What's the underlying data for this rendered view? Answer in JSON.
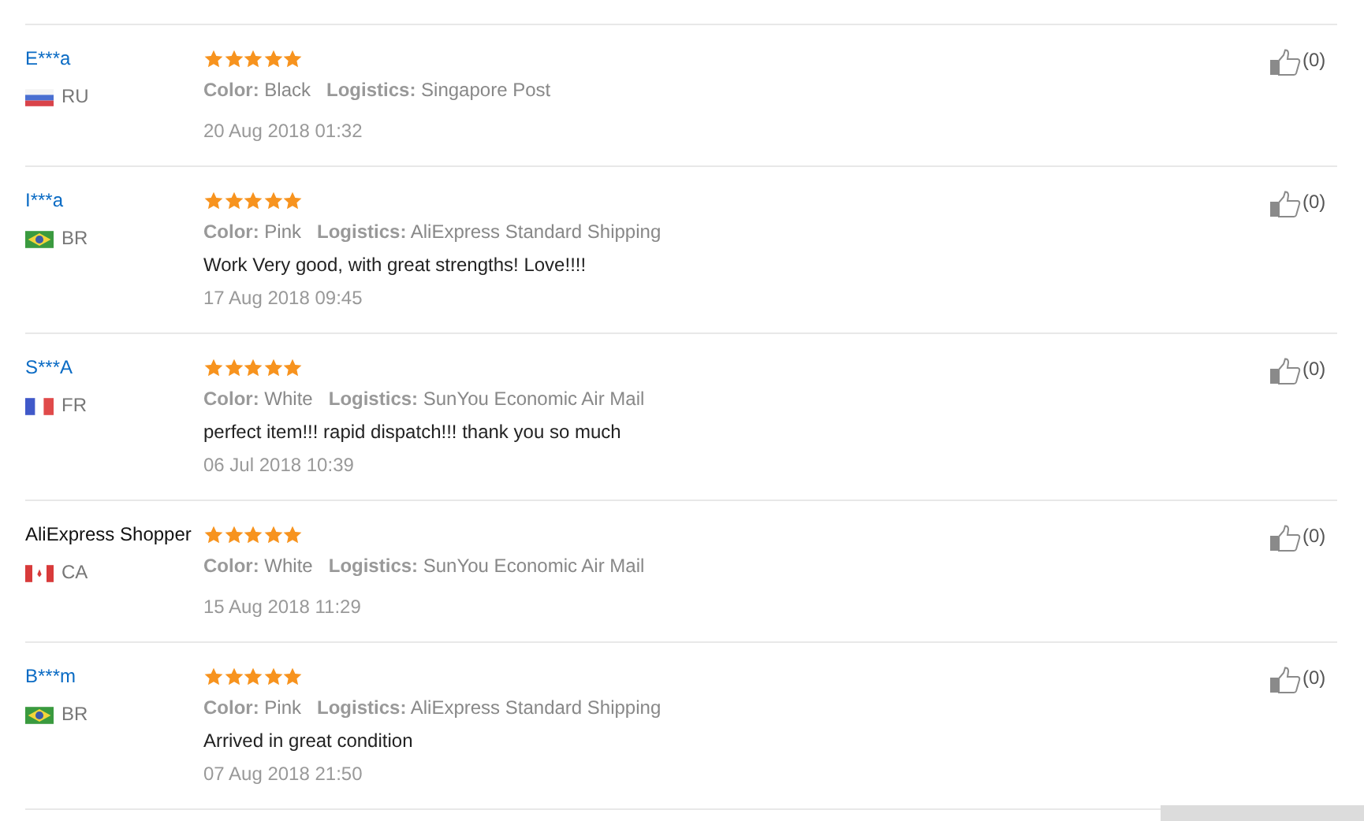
{
  "reviews": [
    {
      "name": "E***a",
      "name_link": true,
      "flag": {
        "kind": "ru"
      },
      "country": "RU",
      "stars": 5,
      "color_label": "Color:",
      "color_value": "Black",
      "logistics_label": "Logistics:",
      "logistics_value": "Singapore Post",
      "date": "20 Aug 2018 01:32",
      "likes": "(0)"
    },
    {
      "name": "I***a",
      "name_link": true,
      "flag": {
        "kind": "br"
      },
      "country": "BR",
      "stars": 5,
      "color_label": "Color:",
      "color_value": "Pink",
      "logistics_label": "Logistics:",
      "logistics_value": "AliExpress Standard Shipping",
      "comment": "Work Very good, with great strengths! Love!!!!",
      "date": "17 Aug 2018 09:45",
      "likes": "(0)"
    },
    {
      "name": "S***A",
      "name_link": true,
      "flag": {
        "kind": "fr"
      },
      "country": "FR",
      "stars": 5,
      "color_label": "Color:",
      "color_value": "White",
      "logistics_label": "Logistics:",
      "logistics_value": "SunYou Economic Air Mail",
      "comment": "perfect item!!! rapid dispatch!!! thank you so much",
      "date": "06 Jul 2018 10:39",
      "likes": "(0)"
    },
    {
      "name": "AliExpress Shopper",
      "name_link": false,
      "flag": {
        "kind": "ca"
      },
      "country": "CA",
      "stars": 5,
      "color_label": "Color:",
      "color_value": "White",
      "logistics_label": "Logistics:",
      "logistics_value": "SunYou Economic Air Mail",
      "date": "15 Aug 2018 11:29",
      "likes": "(0)"
    },
    {
      "name": "B***m",
      "name_link": true,
      "flag": {
        "kind": "br"
      },
      "country": "BR",
      "stars": 5,
      "color_label": "Color:",
      "color_value": "Pink",
      "logistics_label": "Logistics:",
      "logistics_value": "AliExpress Standard Shipping",
      "comment": "Arrived in great condition",
      "date": "07 Aug 2018 21:50",
      "likes": "(0)"
    }
  ]
}
